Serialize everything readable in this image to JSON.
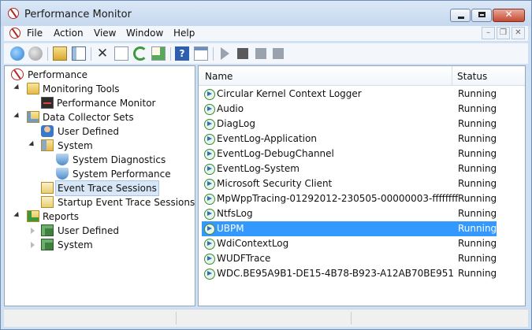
{
  "window": {
    "title": "Performance Monitor"
  },
  "menu": {
    "items": [
      "File",
      "Action",
      "View",
      "Window",
      "Help"
    ]
  },
  "tree": {
    "root": "Performance",
    "monitoring_tools": "Monitoring Tools",
    "performance_monitor": "Performance Monitor",
    "data_collector_sets": "Data Collector Sets",
    "user_defined": "User Defined",
    "system": "System",
    "system_diagnostics": "System Diagnostics",
    "system_performance": "System Performance",
    "event_trace_sessions": "Event Trace Sessions",
    "startup_event_trace_sessions": "Startup Event Trace Sessions",
    "reports": "Reports",
    "reports_user_defined": "User Defined",
    "reports_system": "System"
  },
  "list": {
    "columns": {
      "name": "Name",
      "status": "Status"
    },
    "rows": [
      {
        "name": "Circular Kernel Context Logger",
        "status": "Running"
      },
      {
        "name": "Audio",
        "status": "Running"
      },
      {
        "name": "DiagLog",
        "status": "Running"
      },
      {
        "name": "EventLog-Application",
        "status": "Running"
      },
      {
        "name": "EventLog-DebugChannel",
        "status": "Running"
      },
      {
        "name": "EventLog-System",
        "status": "Running"
      },
      {
        "name": "Microsoft Security Client",
        "status": "Running"
      },
      {
        "name": "MpWppTracing-01292012-230505-00000003-ffffffff",
        "status": "Running"
      },
      {
        "name": "NtfsLog",
        "status": "Running"
      },
      {
        "name": "UBPM",
        "status": "Running",
        "selected": true
      },
      {
        "name": "WdiContextLog",
        "status": "Running"
      },
      {
        "name": "WUDFTrace",
        "status": "Running"
      },
      {
        "name": "WDC.BE95A9B1-DE15-4B78-B923-A12AB70BE951",
        "status": "Running"
      }
    ]
  },
  "colors": {
    "selection": "#3399ff",
    "tree_selection": "#d8e7f7"
  }
}
